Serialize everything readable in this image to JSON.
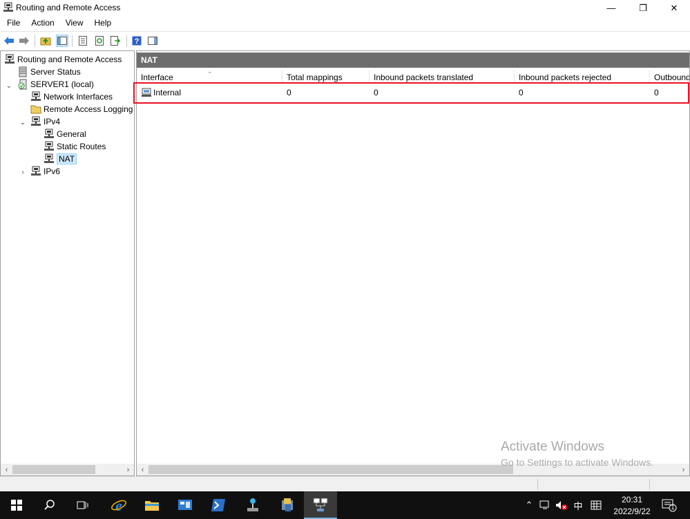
{
  "window": {
    "title": "Routing and Remote Access",
    "controls": {
      "minimize": "—",
      "maximize": "❐",
      "close": "✕"
    }
  },
  "menu": [
    "File",
    "Action",
    "View",
    "Help"
  ],
  "toolbar": {
    "icons": [
      "back-arrow-icon",
      "forward-arrow-icon",
      "up-folder-icon",
      "show-hide-console-tree-icon",
      "properties-icon",
      "refresh-icon",
      "export-list-icon",
      "help-icon",
      "show-hide-action-pane-icon"
    ]
  },
  "tree": {
    "root": "Routing and Remote Access",
    "server_status": "Server Status",
    "server": "SERVER1 (local)",
    "network_interfaces": "Network Interfaces",
    "remote_access_logging": "Remote Access Logging",
    "ipv4": "IPv4",
    "general": "General",
    "static_routes": "Static Routes",
    "nat": "NAT",
    "ipv6": "IPv6",
    "expand_collapsed": "›",
    "expand_open": "⌄"
  },
  "main": {
    "header": "NAT",
    "columns": [
      "Interface",
      "Total mappings",
      "Inbound packets translated",
      "Inbound packets rejected",
      "Outbound"
    ],
    "rows": [
      {
        "interface": "Internal",
        "total_mappings": "0",
        "inbound_translated": "0",
        "inbound_rejected": "0",
        "outbound": "0"
      }
    ]
  },
  "watermark": {
    "line1": "Activate Windows",
    "line2": "Go to Settings to activate Windows."
  },
  "taskbar": {
    "clock_time": "20:31",
    "clock_date": "2022/9/22",
    "ime": "中",
    "notification_count": "1",
    "apps": [
      "start-icon",
      "search-icon",
      "task-view-icon",
      "internet-explorer-icon",
      "file-explorer-icon",
      "server-manager-icon",
      "powershell-icon",
      "network-tool-icon",
      "admin-tools-icon",
      "routing-remote-access-icon"
    ]
  },
  "colors": {
    "accent_highlight": "#e81123",
    "pane_header": "#6d6d6d",
    "taskbar": "#101010",
    "selection": "#cce8ff"
  }
}
